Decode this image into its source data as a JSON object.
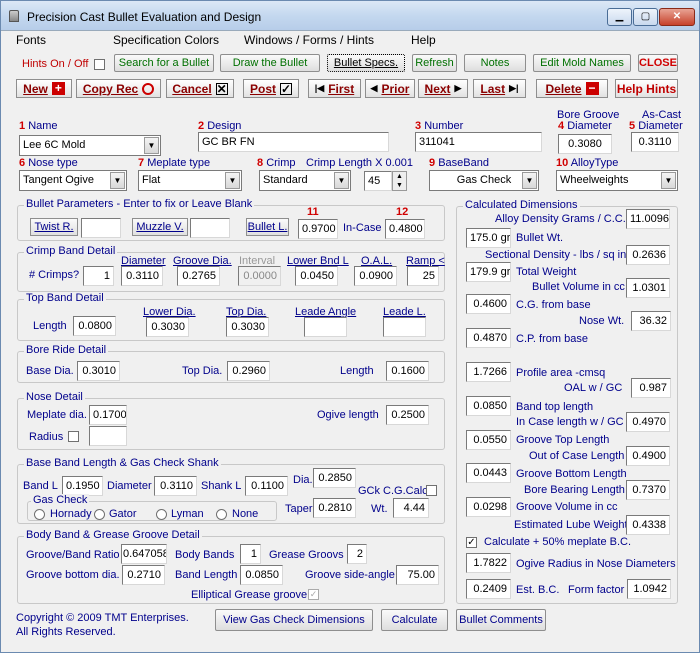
{
  "window": {
    "title": "Precision Cast Bullet Evaluation and Design",
    "min": "▁",
    "max": "▢",
    "close": "✕"
  },
  "menu": [
    "Fonts",
    "Specification Colors",
    "Windows / Forms / Hints",
    "Help"
  ],
  "toolbar1": {
    "hints_label": "Hints On / Off",
    "search": "Search for a Bullet",
    "draw": "Draw the Bullet",
    "specs": "Bullet Specs.",
    "refresh": "Refresh",
    "notes": "Notes",
    "edit_molds": "Edit Mold Names",
    "close": "CLOSE"
  },
  "toolbar2": {
    "new": "New",
    "copy": "Copy Rec",
    "cancel": "Cancel",
    "post": "Post",
    "first": "First",
    "prior": "Prior",
    "next": "Next",
    "last": "Last",
    "delete": "Delete",
    "help_hints": "Help Hints"
  },
  "header": {
    "name_num": "1",
    "name_label": "Name",
    "name_value": "Lee 6C Mold",
    "design_num": "2",
    "design_label": "Design",
    "design_value": "GC BR FN",
    "number_num": "3",
    "number_label": "Number",
    "number_value": "311041",
    "bore_label1": "Bore Groove",
    "bore_num": "4",
    "bore_label2": "Diameter",
    "bore_value": "0.3080",
    "ascast_label1": "As-Cast",
    "ascast_num": "5",
    "ascast_label2": "Diameter",
    "ascast_value": "0.3110",
    "nose_num": "6",
    "nose_label": "Nose type",
    "nose_value": "Tangent Ogive",
    "meplate_num": "7",
    "meplate_label": "Meplate type",
    "meplate_value": "Flat",
    "crimp_num": "8",
    "crimp_label": "Crimp",
    "crimp_len_label": "Crimp Length X 0.001",
    "crimp_value": "Standard",
    "crimp_len_value": "45",
    "baseband_num": "9",
    "baseband_label": "BaseBand",
    "baseband_value": "Gas Check",
    "alloy_num": "10",
    "alloy_label": "AlloyType",
    "alloy_value": "Wheelweights"
  },
  "bullet_params": {
    "title": "Bullet Parameters - Enter to fix or Leave Blank",
    "twist": "Twist R.",
    "twist_value": "",
    "muzzle": "Muzzle V.",
    "muzzle_value": "",
    "bullet_l": "Bullet L.",
    "num11": "11",
    "bullet_l_value": "0.9700",
    "incase": "In-Case",
    "num12": "12",
    "incase_value": "0.4800"
  },
  "crimp_band": {
    "title": "Crimp Band Detail",
    "crimps_label": "# Crimps?",
    "crimps_value": "1",
    "diameter": "Diameter",
    "diameter_value": "0.3110",
    "groove_dia": "Groove Dia.",
    "groove_dia_value": "0.2765",
    "interval": "Interval",
    "interval_value": "0.0000",
    "lower_bnd": "Lower Bnd L",
    "lower_bnd_value": "0.0450",
    "oal": "O.A.L.",
    "oal_value": "0.0900",
    "ramp": "Ramp <",
    "ramp_value": "25"
  },
  "top_band": {
    "title": "Top Band Detail",
    "length": "Length",
    "length_value": "0.0800",
    "lower_dia": "Lower Dia.",
    "lower_dia_value": "0.3030",
    "top_dia": "Top Dia.",
    "top_dia_value": "0.3030",
    "leade_angle": "Leade Angle",
    "leade_angle_value": "",
    "leade_l": "Leade L.",
    "leade_l_value": ""
  },
  "bore_ride": {
    "title": "Bore Ride Detail",
    "base_dia": "Base Dia.",
    "base_dia_value": "0.3010",
    "top_dia": "Top Dia.",
    "top_dia_value": "0.2960",
    "length": "Length",
    "length_value": "0.1600"
  },
  "nose_detail": {
    "title": "Nose Detail",
    "meplate_dia": "Meplate dia.",
    "meplate_dia_value": "0.1700",
    "radius": "Radius",
    "radius_value": "",
    "ogive_length": "Ogive length",
    "ogive_length_value": "0.2500"
  },
  "base_band": {
    "title": "Base Band Length & Gas Check Shank",
    "band_l": "Band L",
    "band_l_value": "0.1950",
    "diameter": "Diameter",
    "diameter_value": "0.3110",
    "shank_l": "Shank L",
    "shank_l_value": "0.1100",
    "dia": "Dia.",
    "dia_value": "0.2850",
    "gck": "GCk C.G.Calc",
    "taper": "Taper",
    "taper_value": "0.2810",
    "wt": "Wt.",
    "wt_value": "4.44",
    "gas_check_title": "Gas Check",
    "gc_options": [
      "Hornady",
      "Gator",
      "Lyman",
      "None"
    ]
  },
  "body_band": {
    "title": "Body Band & Grease Groove Detail",
    "ratio": "Groove/Band Ratio",
    "ratio_value": "0.647058",
    "body_bands": "Body Bands",
    "body_bands_value": "1",
    "grease_groovs": "Grease Groovs",
    "grease_groovs_value": "2",
    "groove_bottom": "Groove bottom dia.",
    "groove_bottom_value": "0.2710",
    "band_length": "Band Length",
    "band_length_value": "0.0850",
    "side_angle": "Groove side-angle",
    "side_angle_value": "75.00",
    "elliptical": "Elliptical Grease groove"
  },
  "calc": {
    "title": "Calculated Dimensions",
    "alloy_density": "Alloy Density Grams / C.C.",
    "alloy_density_value": "11.0096",
    "bullet_wt_value": "175.0 gr",
    "bullet_wt": "Bullet Wt.",
    "sectional": "Sectional Density - lbs / sq in",
    "sectional_value": "0.2636",
    "total_weight_value": "179.9 gr",
    "total_weight": "Total  Weight",
    "bullet_volume": "Bullet Volume in cc",
    "bullet_volume_value": "1.0301",
    "cg_value": "0.4600",
    "cg": "C.G. from base",
    "nose_wt": "Nose Wt.",
    "nose_wt_value": "36.32",
    "cp_value": "0.4870",
    "cp": "C.P. from base",
    "profile_value": "1.7266",
    "profile": "Profile area -cmsq",
    "oal_gc": "OAL w / GC",
    "oal_gc_value": "0.987",
    "band_top_value": "0.0850",
    "band_top": "Band top length",
    "incase_gc": "In Case length w / GC",
    "incase_gc_value": "0.4970",
    "groove_top_value": "0.0550",
    "groove_top": "Groove Top Length",
    "out_case": "Out of Case Length",
    "out_case_value": "0.4900",
    "groove_bottom_value": "0.0443",
    "groove_bottom": "Groove Bottom Length",
    "bearing": "Bore Bearing Length",
    "bearing_value": "0.7370",
    "groove_volume_value": "0.0298",
    "groove_volume": "Groove Volume in cc",
    "lube": "Estimated Lube Weight",
    "lube_value": "0.4338",
    "meplate_bc": "Calculate + 50% meplate B.C.",
    "ogive_radius_value": "1.7822",
    "ogive_radius": "Ogive Radius in Nose Diameters",
    "est_bc_value": "0.2409",
    "est_bc": "Est. B.C.",
    "form_factor": "Form factor",
    "form_factor_value": "1.0942"
  },
  "footer": {
    "copyright1": "Copyright © 2009 TMT Enterprises.",
    "copyright2": "All Rights Reserved.",
    "gas_check_dims": "View Gas Check Dimensions",
    "calculate": "Calculate",
    "comments": "Bullet Comments"
  }
}
